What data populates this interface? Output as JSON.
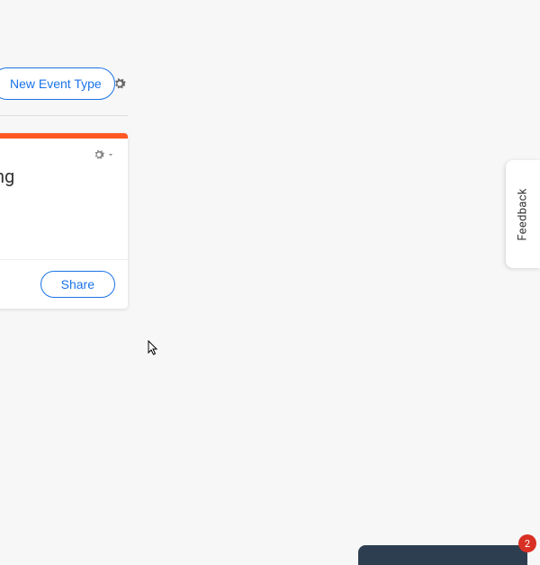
{
  "toolbar": {
    "new_event_label": "New Event Type"
  },
  "card": {
    "title_fragment": "ng",
    "share_label": "Share",
    "accent_color": "#ff5722"
  },
  "feedback": {
    "label": "Feedback"
  },
  "chat": {
    "badge_count": "2"
  }
}
